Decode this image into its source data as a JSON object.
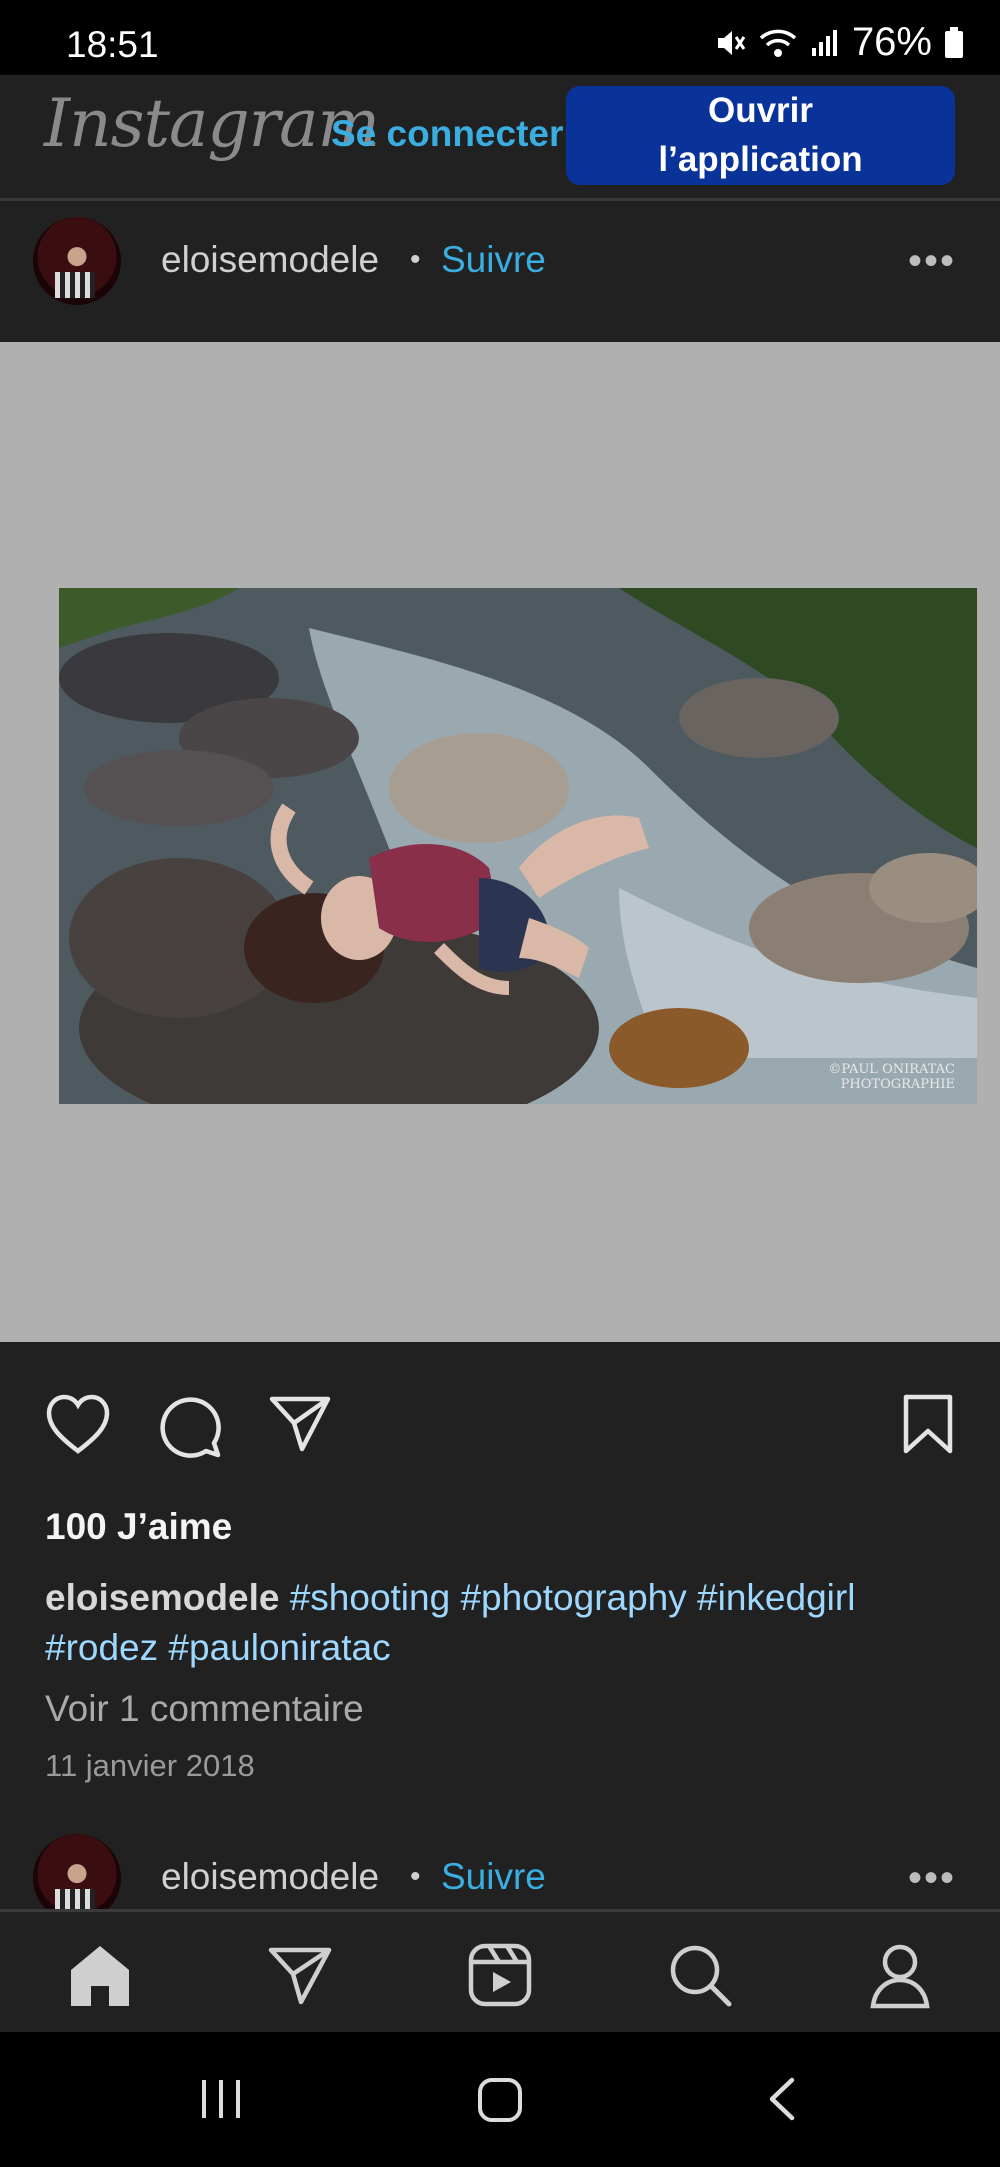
{
  "status_bar": {
    "time": "18:51",
    "battery": "76%"
  },
  "header": {
    "logo": "Instagram",
    "login": "Se connecter",
    "open_app_line1": "Ouvrir",
    "open_app_line2": "l’application"
  },
  "post": {
    "username": "eloisemodele",
    "separator": "•",
    "follow": "Suivre",
    "more": "•••",
    "likes": "100 J’aime",
    "caption_user": "eloisemodele",
    "caption_tags": "#shooting #photography #inkedgirl #rodez #paulonirataс",
    "view_comments": "Voir 1 commentaire",
    "date": "11 janvier 2018",
    "watermark": "©PAUL ONIRATAC PHOTOGRAPHIE"
  },
  "next_post": {
    "username": "eloisemodele",
    "separator": "•",
    "follow": "Suivre",
    "more": "•••"
  },
  "icons": {
    "like": "heart-icon",
    "comment": "comment-icon",
    "share": "send-icon",
    "save": "bookmark-icon",
    "home": "home-icon",
    "direct": "send-icon",
    "reels": "reels-icon",
    "search": "search-icon",
    "profile": "profile-icon"
  },
  "colors": {
    "link": "#3aaee0",
    "button": "#0a3399",
    "background": "#212121",
    "hashtag": "#9fd8ff"
  }
}
